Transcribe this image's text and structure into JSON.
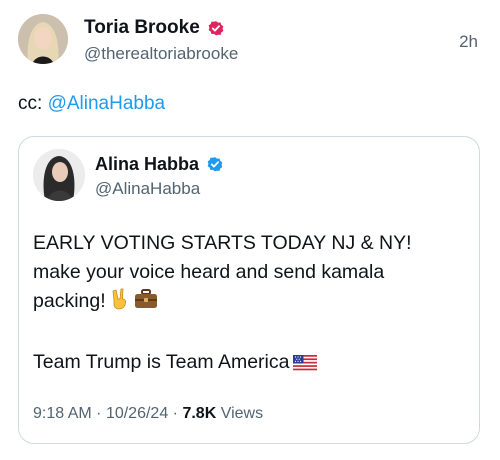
{
  "outer_tweet": {
    "display_name": "Toria Brooke",
    "handle": "@therealtoriabrooke",
    "timestamp": "2h",
    "text_prefix": "cc: ",
    "mention": "@AlinaHabba"
  },
  "quoted_tweet": {
    "display_name": "Alina Habba",
    "handle": "@AlinaHabba",
    "lines": [
      "EARLY VOTING STARTS TODAY NJ & NY!",
      "make your voice heard and send kamala",
      "packing!",
      "Team Trump is Team America"
    ],
    "time": "9:18 AM",
    "date": "10/26/24",
    "views_count": "7.8K",
    "views_label": "Views"
  },
  "colors": {
    "text": "#0f1419",
    "secondary": "#536471",
    "link": "#1d9bf0",
    "verified_pink": "#e0245e",
    "verified_blue": "#1d9bf0",
    "border": "#cfd9de"
  },
  "icons": [
    "avatar-toria",
    "verified-badge-pink",
    "avatar-alina",
    "verified-badge-blue",
    "victory-hand-emoji",
    "briefcase-emoji",
    "us-flag-emoji"
  ]
}
